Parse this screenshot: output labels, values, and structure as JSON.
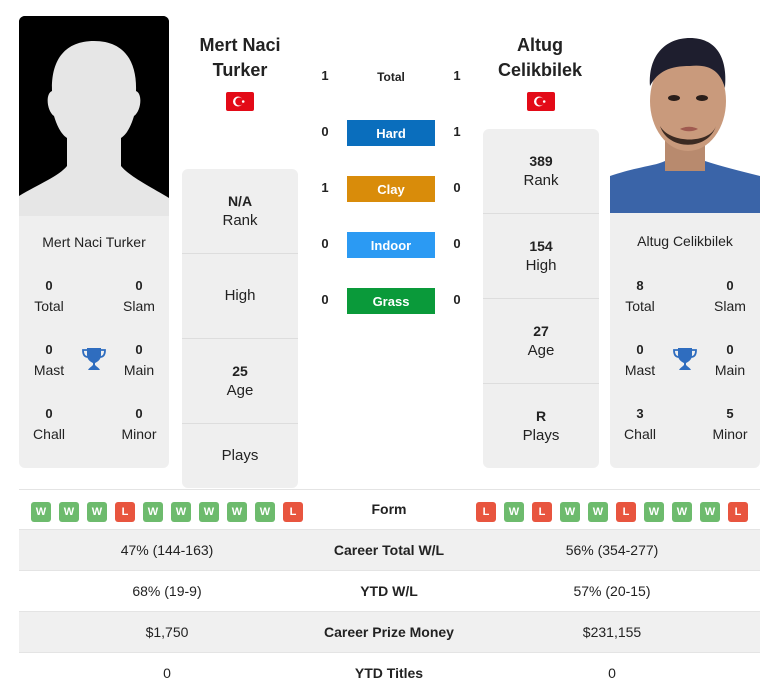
{
  "player1": {
    "name_line1": "Mert Naci",
    "name_line2": "Turker",
    "full_name": "Mert Naci Turker",
    "country": "Turkey",
    "flag_icon": "turkey-flag-icon",
    "photo": "silhouette-placeholder",
    "stats": {
      "total": {
        "value": "0",
        "label": "Total"
      },
      "slam": {
        "value": "0",
        "label": "Slam"
      },
      "mast": {
        "value": "0",
        "label": "Mast"
      },
      "main": {
        "value": "0",
        "label": "Main"
      },
      "chall": {
        "value": "0",
        "label": "Chall"
      },
      "minor": {
        "value": "0",
        "label": "Minor"
      }
    },
    "info": {
      "rank": {
        "value": "N/A",
        "label": "Rank"
      },
      "high": {
        "value": "",
        "label": "High"
      },
      "age": {
        "value": "25",
        "label": "Age"
      },
      "plays": {
        "value": "",
        "label": "Plays"
      }
    },
    "form": [
      "W",
      "W",
      "W",
      "L",
      "W",
      "W",
      "W",
      "W",
      "W",
      "L"
    ]
  },
  "player2": {
    "name_line1": "Altug",
    "name_line2": "Celikbilek",
    "full_name": "Altug Celikbilek",
    "country": "Turkey",
    "flag_icon": "turkey-flag-icon",
    "photo": "player-photo",
    "stats": {
      "total": {
        "value": "8",
        "label": "Total"
      },
      "slam": {
        "value": "0",
        "label": "Slam"
      },
      "mast": {
        "value": "0",
        "label": "Mast"
      },
      "main": {
        "value": "0",
        "label": "Main"
      },
      "chall": {
        "value": "3",
        "label": "Chall"
      },
      "minor": {
        "value": "5",
        "label": "Minor"
      }
    },
    "info": {
      "rank": {
        "value": "389",
        "label": "Rank"
      },
      "high": {
        "value": "154",
        "label": "High"
      },
      "age": {
        "value": "27",
        "label": "Age"
      },
      "plays": {
        "value": "R",
        "label": "Plays"
      }
    },
    "form": [
      "L",
      "W",
      "L",
      "W",
      "W",
      "L",
      "W",
      "W",
      "W",
      "L"
    ]
  },
  "h2h": {
    "total": {
      "label": "Total",
      "p1": "1",
      "p2": "1"
    },
    "surfaces": [
      {
        "label": "Hard",
        "p1": "0",
        "p2": "1",
        "color": "#0a6ebd"
      },
      {
        "label": "Clay",
        "p1": "1",
        "p2": "0",
        "color": "#d98c0a"
      },
      {
        "label": "Indoor",
        "p1": "0",
        "p2": "0",
        "color": "#2b9af3"
      },
      {
        "label": "Grass",
        "p1": "0",
        "p2": "0",
        "color": "#0a9a3a"
      }
    ]
  },
  "form_label": "Form",
  "comparison": [
    {
      "label": "Career Total W/L",
      "p1": "47% (144-163)",
      "p2": "56% (354-277)"
    },
    {
      "label": "YTD W/L",
      "p1": "68% (19-9)",
      "p2": "57% (20-15)"
    },
    {
      "label": "Career Prize Money",
      "p1": "$1,750",
      "p2": "$231,155"
    },
    {
      "label": "YTD Titles",
      "p1": "0",
      "p2": "0"
    }
  ],
  "colors": {
    "win": "#6dbb6d",
    "loss": "#e8553f",
    "trophy": "#2f6dbf",
    "card_bg": "#efefef"
  }
}
